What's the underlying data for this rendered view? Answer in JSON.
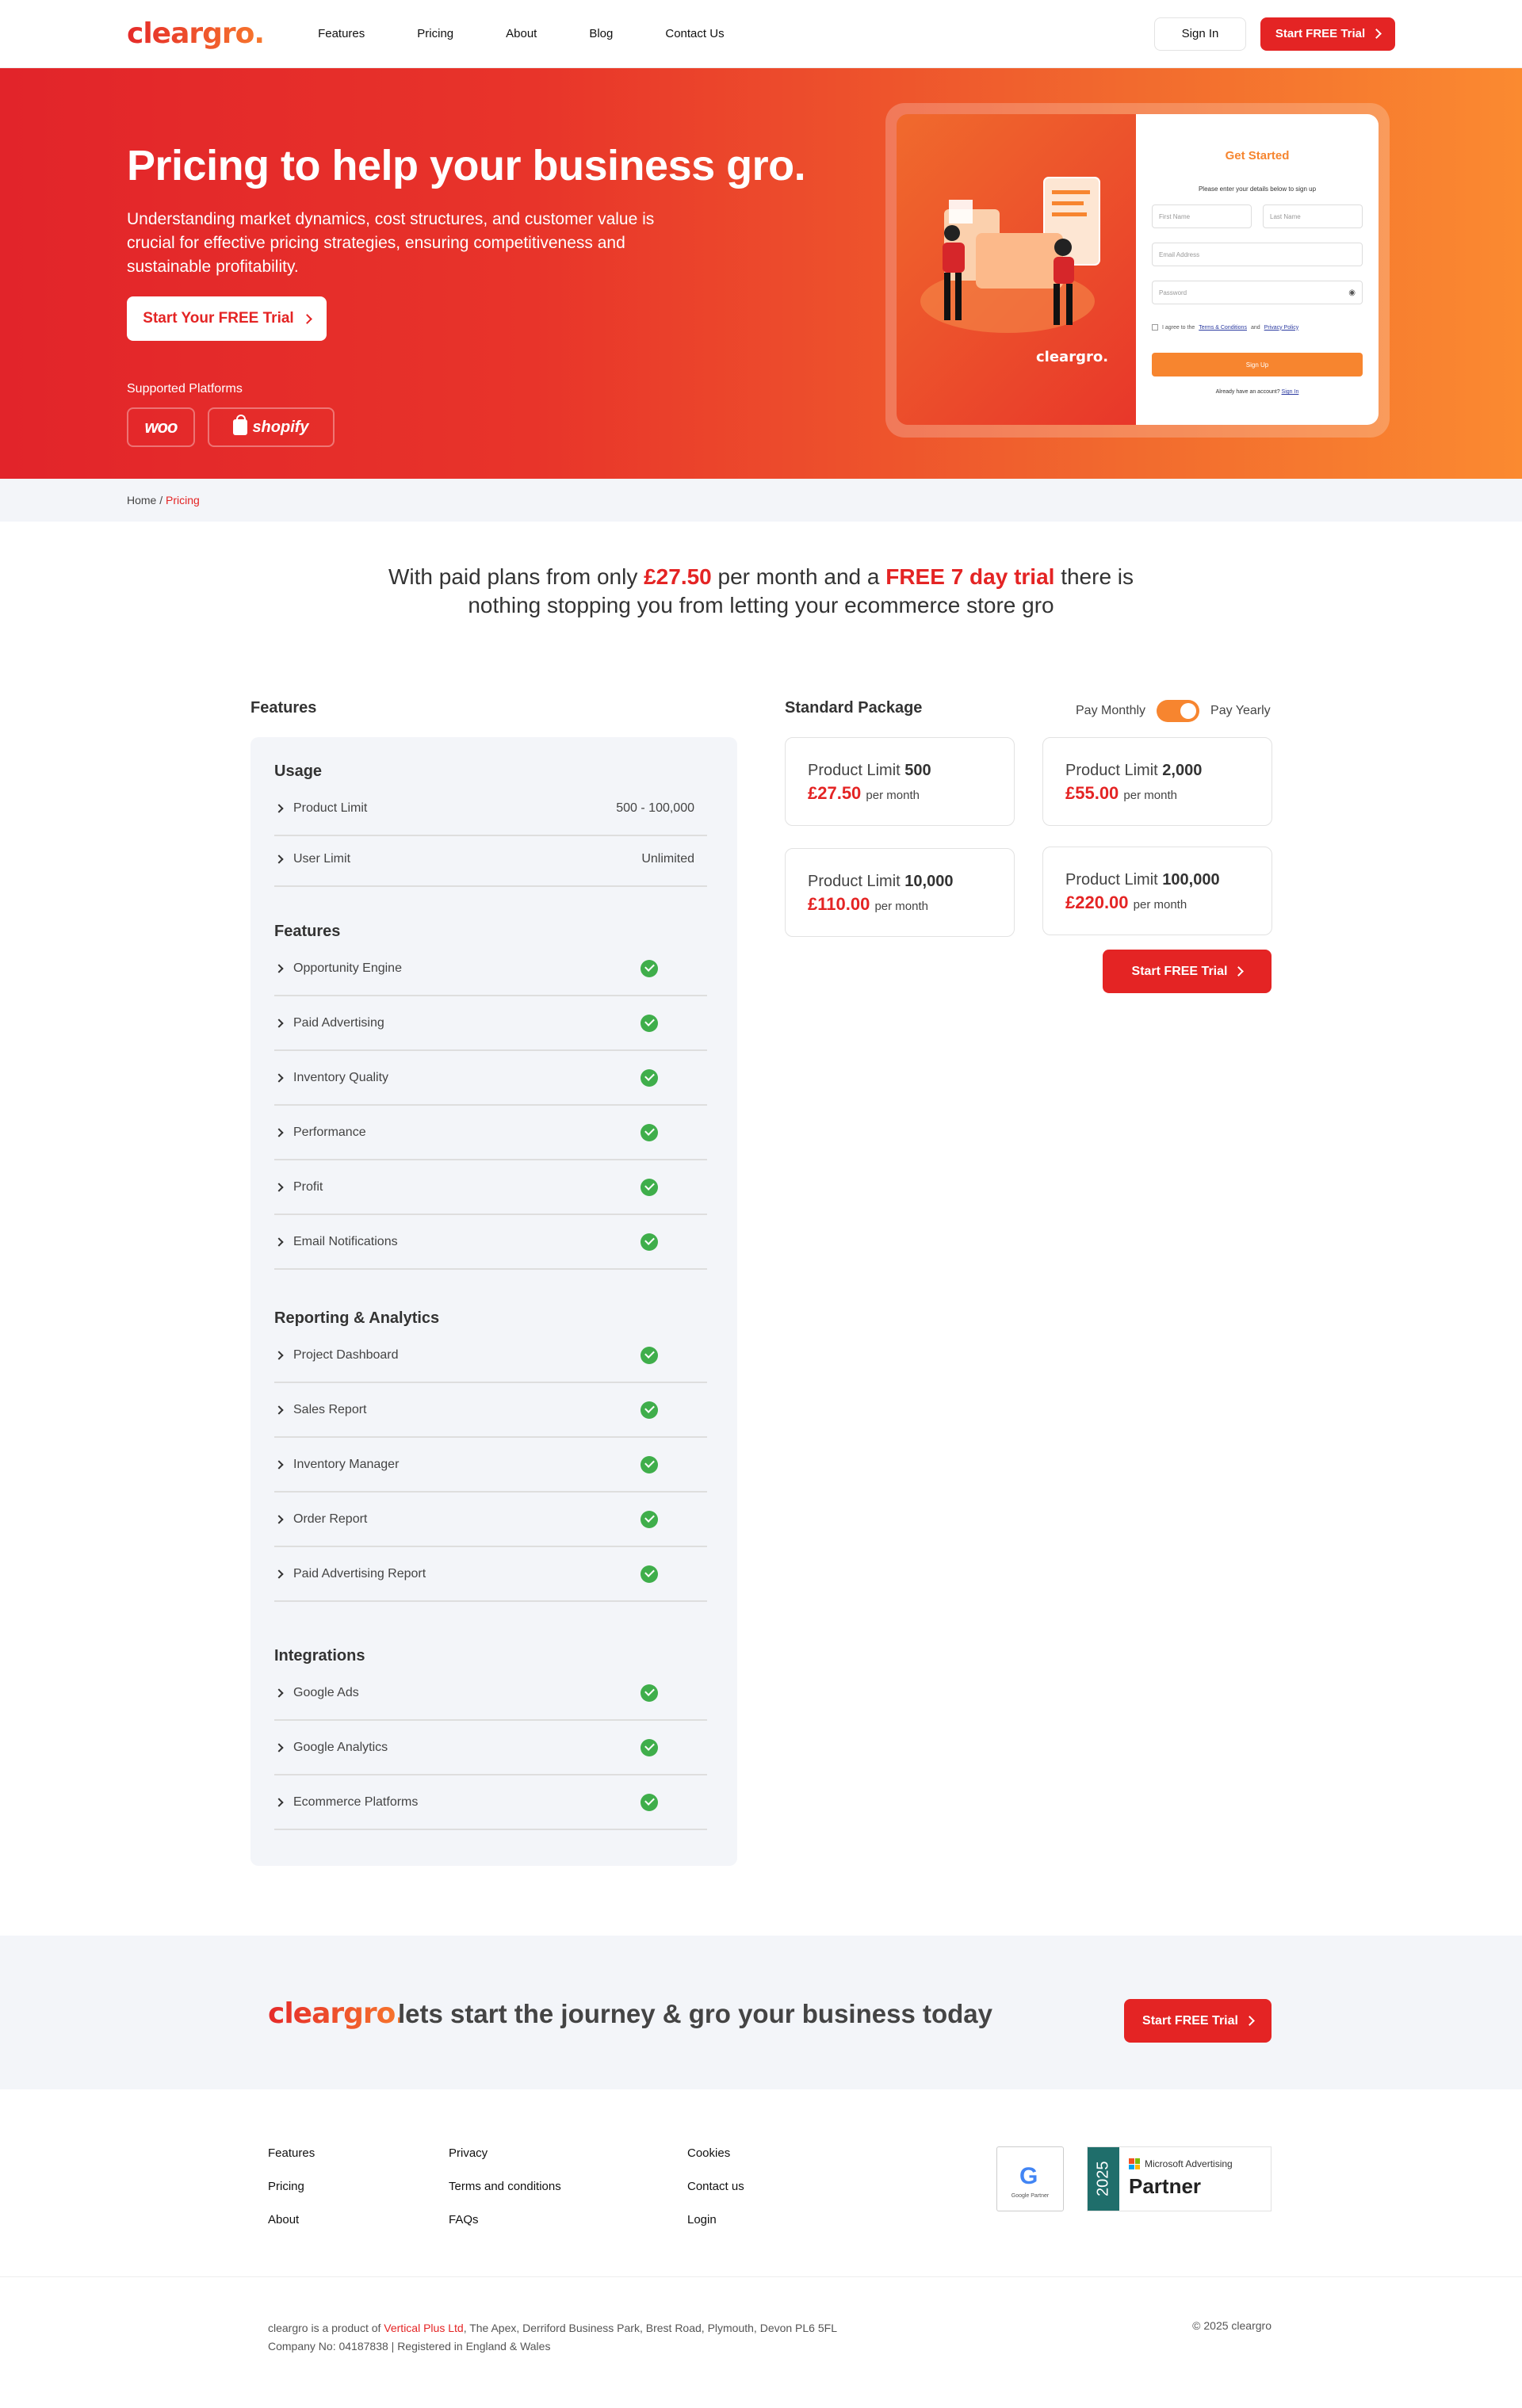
{
  "nav": {
    "logo": "cleargro.",
    "links": [
      "Features",
      "Pricing",
      "About",
      "Blog",
      "Contact Us"
    ],
    "sign_in": "Sign In",
    "trial": "Start FREE Trial"
  },
  "hero": {
    "title": "Pricing to help your business gro.",
    "lead": "Understanding market dynamics, cost structures, and customer value is crucial for effective pricing strategies, ensuring competitiveness and sustainable profitability.",
    "cta": "Start Your FREE Trial",
    "platforms_label": "Supported Platforms",
    "platform_woo": "woo",
    "platform_shopify": "shopify"
  },
  "signup_mock": {
    "brand": "cleargro.",
    "title": "Get Started",
    "subtitle": "Please enter your details below to sign up",
    "first_name": "First Name",
    "last_name": "Last Name",
    "email": "Email Address",
    "password": "Password",
    "agree_prefix": "I agree to the",
    "terms": "Terms & Conditions",
    "and": "and",
    "privacy": "Privacy Policy",
    "signup": "Sign Up",
    "have_account": "Already have an account?",
    "signin": "Sign In"
  },
  "breadcrumb": {
    "home": "Home",
    "sep": " / ",
    "current": "Pricing"
  },
  "intro": {
    "p1": "With paid plans from only ",
    "price": "£27.50",
    "p2": " per month and a ",
    "trial": "FREE 7 day trial",
    "p3": " there is",
    "line2": "nothing stopping you from letting your ecommerce store gro"
  },
  "features": {
    "title": "Features",
    "groups": {
      "usage": "Usage",
      "features": "Features",
      "reporting": "Reporting & Analytics",
      "integrations": "Integrations"
    },
    "usage_rows": [
      {
        "label": "Product Limit",
        "value": "500 - 100,000"
      },
      {
        "label": "User Limit",
        "value": "Unlimited"
      }
    ],
    "feature_rows": [
      "Opportunity Engine",
      "Paid Advertising",
      "Inventory Quality",
      "Performance",
      "Profit",
      "Email Notifications"
    ],
    "reporting_rows": [
      "Project Dashboard",
      "Sales Report",
      "Inventory Manager",
      "Order Report",
      "Paid Advertising Report"
    ],
    "integration_rows": [
      "Google Ads",
      "Google Analytics",
      "Ecommerce Platforms"
    ]
  },
  "package": {
    "title": "Standard Package",
    "pay_monthly": "Pay Monthly",
    "pay_yearly": "Pay Yearly",
    "toggle_state": "yearly",
    "limit_label": "Product Limit",
    "per_month": "per month",
    "plans": [
      {
        "limit": "500",
        "price": "£27.50"
      },
      {
        "limit": "2,000",
        "price": "£55.00"
      },
      {
        "limit": "10,000",
        "price": "£110.00"
      },
      {
        "limit": "100,000",
        "price": "£220.00"
      }
    ],
    "cta": "Start FREE Trial"
  },
  "band": {
    "logo": "cleargro.",
    "text": "lets start the journey & gro your business today",
    "cta": "Start FREE Trial"
  },
  "footer": {
    "col1": [
      "Features",
      "Pricing",
      "About"
    ],
    "col2": [
      "Privacy",
      "Terms and conditions",
      "FAQs"
    ],
    "col3": [
      "Cookies",
      "Contact us",
      "Login"
    ],
    "google_badge": "Google Partner",
    "ms_year": "2025",
    "ms_small": "Microsoft Advertising",
    "ms_big": "Partner",
    "line1_prefix": "cleargro is a product of ",
    "company": "Vertical Plus Ltd",
    "line1_suffix": ", The Apex, Derriford Business Park, Brest Road, Plymouth, Devon PL6 5FL",
    "line2": "Company No: 04187838 | Registered in England & Wales",
    "copyright": "© 2025 cleargro"
  },
  "colors": {
    "brand_red": "#e42424",
    "brand_orange": "#f7852f",
    "check_green": "#3fae4b",
    "panel_bg": "#f3f5f9"
  }
}
